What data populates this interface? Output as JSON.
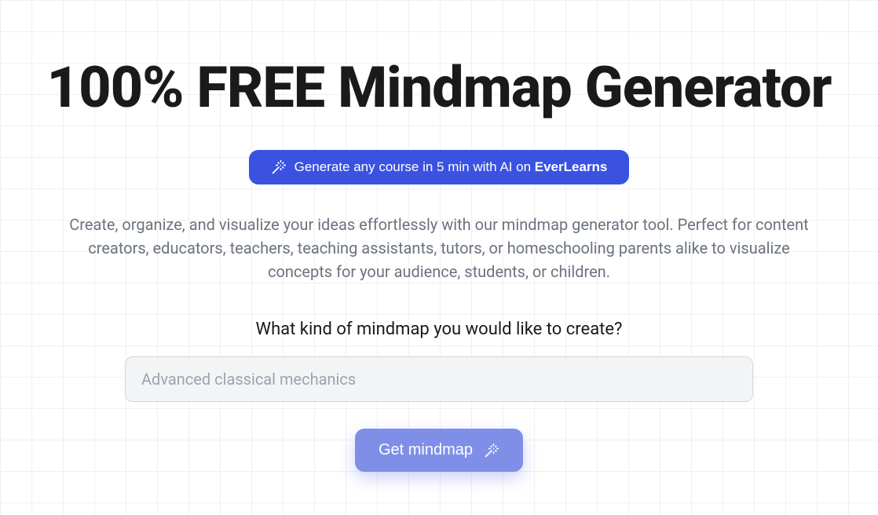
{
  "hero": {
    "title": "100% FREE Mindmap Generator",
    "promo_text_prefix": "Generate any course in 5 min with AI on ",
    "promo_text_bold": "EverLearns",
    "description": "Create, organize, and visualize your ideas effortlessly with our mindmap generator tool. Perfect for content creators, educators, teachers, teaching assistants, tutors, or homeschooling parents alike to visualize concepts for your audience, students, or children."
  },
  "form": {
    "prompt_label": "What kind of mindmap you would like to create?",
    "input_placeholder": "Advanced classical mechanics",
    "submit_label": "Get mindmap"
  }
}
